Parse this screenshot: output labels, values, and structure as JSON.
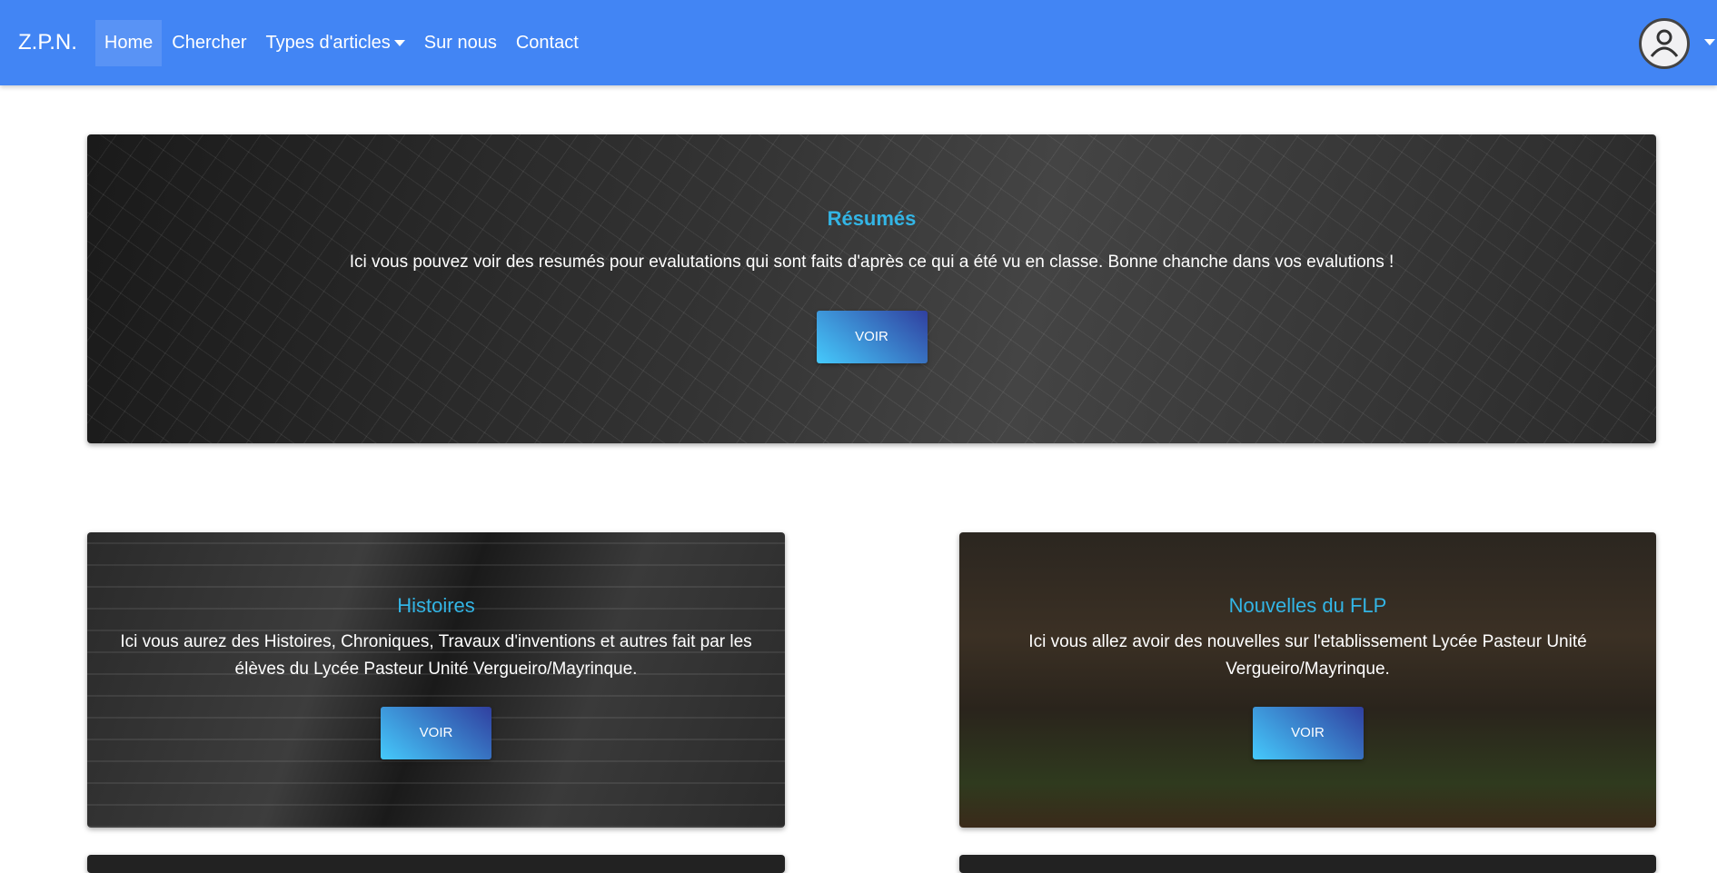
{
  "navbar": {
    "brand": "Z.P.N.",
    "items": [
      {
        "label": "Home",
        "active": true
      },
      {
        "label": "Chercher"
      },
      {
        "label": "Types d'articles",
        "dropdown": true
      },
      {
        "label": "Sur nous"
      },
      {
        "label": "Contact"
      }
    ],
    "avatar_icon": "user-circle-icon"
  },
  "hero": {
    "title": "Résumés",
    "text": "Ici vous pouvez voir des resumés pour evalutations qui sont faits d'après ce qui a été vu en classe. Bonne chanche dans vos evalutions !",
    "button": "VOIR"
  },
  "cards": [
    {
      "title": "Histoires",
      "text": "Ici vous aurez des Histoires, Chroniques, Travaux d'inventions et autres fait par les élèves du Lycée Pasteur Unité Vergueiro/Mayrinque.",
      "button": "VOIR"
    },
    {
      "title": "Nouvelles du FLP",
      "text": "Ici vous allez avoir des nouvelles sur l'etablissement Lycée Pasteur Unité Vergueiro/Mayrinque.",
      "button": "VOIR"
    }
  ],
  "colors": {
    "navbar": "#4285f4",
    "title": "#33b5e5"
  }
}
